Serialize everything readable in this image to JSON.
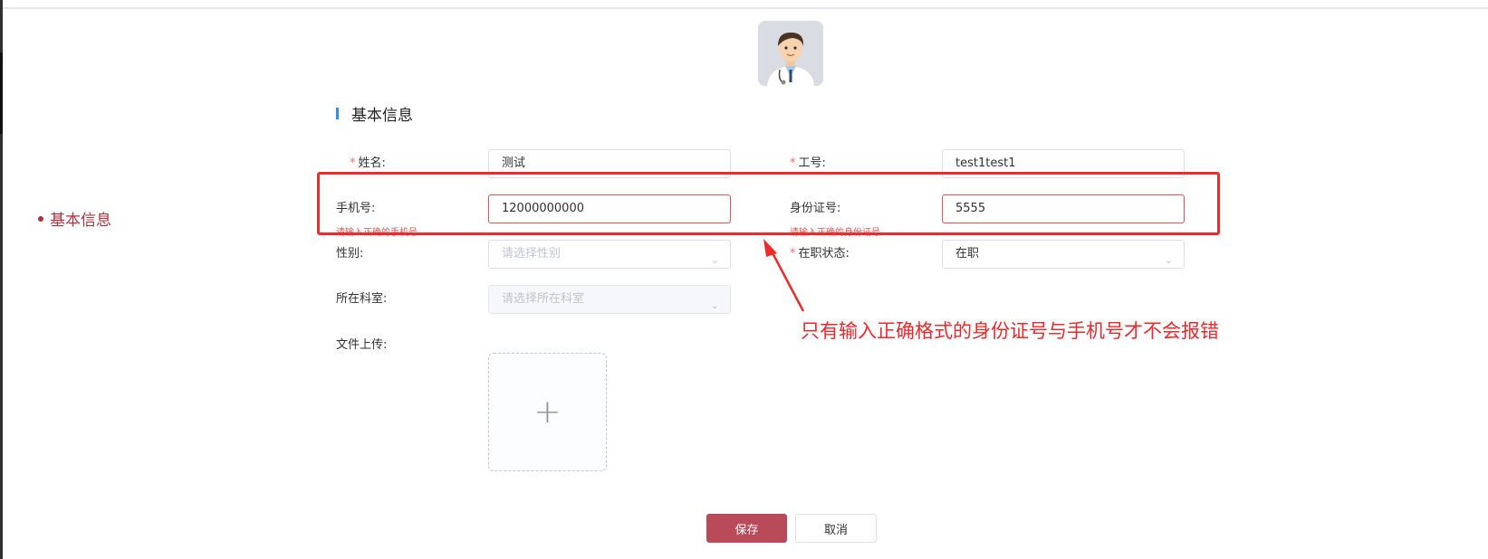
{
  "side_nav": {
    "item_label": "基本信息"
  },
  "section": {
    "title": "基本信息"
  },
  "form": {
    "required_mark": "*",
    "name": {
      "label": "姓名:",
      "value": "测试"
    },
    "employee_id": {
      "label": "工号:",
      "value": "test1test1"
    },
    "phone": {
      "label": "手机号:",
      "value": "12000000000",
      "error": "请输入正确的手机号"
    },
    "id_card": {
      "label": "身份证号:",
      "value": "5555",
      "error": "请输入正确的身份证号"
    },
    "gender": {
      "label": "性别:",
      "placeholder": "请选择性别"
    },
    "employment_status": {
      "label": "在职状态:",
      "value": "在职"
    },
    "department": {
      "label": "所在科室:",
      "placeholder": "请选择所在科室"
    },
    "upload": {
      "label": "文件上传:",
      "icon": "+"
    }
  },
  "buttons": {
    "save": "保存",
    "cancel": "取消"
  },
  "annotation": {
    "text": "只有输入正确格式的身份证号与手机号才不会报错",
    "color": "#f0282a"
  },
  "colors": {
    "accent": "#b94a5a",
    "error": "#e0534f",
    "section_bar": "#2d8cf0"
  },
  "icons": {
    "avatar": "doctor-avatar",
    "chevron": "chevron-down-icon",
    "plus": "plus-icon"
  }
}
